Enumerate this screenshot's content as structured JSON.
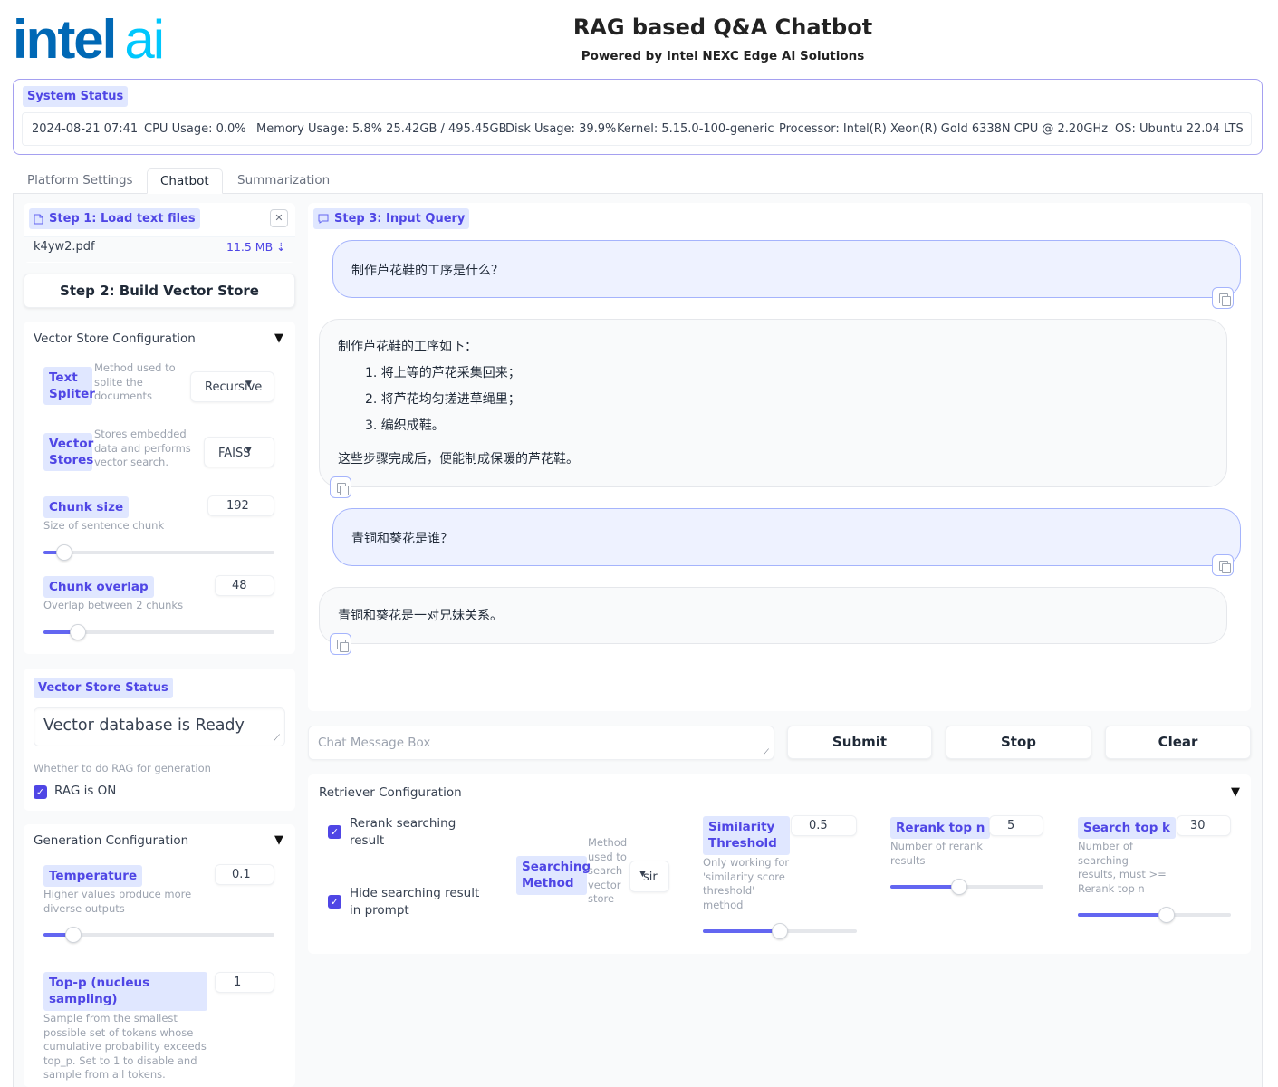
{
  "header": {
    "logo_intel": "intel",
    "logo_ai": "ai",
    "title": "RAG based Q&A Chatbot",
    "subtitle": "Powered by Intel NEXC Edge AI Solutions"
  },
  "system_status": {
    "label": "System Status",
    "datetime": "2024-08-21 07:41",
    "cpu": "CPU Usage: 0.0%",
    "memory": "Memory Usage: 5.8% 25.42GB / 495.45GB",
    "disk": "Disk Usage: 39.9%",
    "kernel": "Kernel: 5.15.0-100-generic",
    "processor": "Processor: Intel(R) Xeon(R) Gold 6338N CPU @ 2.20GHz",
    "os": "OS: Ubuntu 22.04 LTS"
  },
  "tabs": [
    {
      "label": "Platform Settings"
    },
    {
      "label": "Chatbot"
    },
    {
      "label": "Summarization"
    }
  ],
  "step1": {
    "label": "Step 1: Load text files",
    "file_name": "k4yw2.pdf",
    "file_size": "11.5 MB ⇣"
  },
  "step2": {
    "label": "Step 2: Build Vector Store"
  },
  "vector_store_config": {
    "title": "Vector Store Configuration",
    "text_splitter": {
      "label": "Text Spliter",
      "info": "Method used to splite the documents",
      "value": "Recursive"
    },
    "vector_stores": {
      "label": "Vector Stores",
      "info": "Stores embedded data and performs vector search.",
      "value": "FAISS"
    },
    "chunk_size": {
      "label": "Chunk size",
      "info": "Size of sentence chunk",
      "value": "192",
      "fraction": 0.09
    },
    "chunk_overlap": {
      "label": "Chunk overlap",
      "info": "Overlap between 2 chunks",
      "value": "48",
      "fraction": 0.15
    }
  },
  "vector_store_status": {
    "label": "Vector Store Status",
    "value": "Vector database is Ready",
    "rag_info": "Whether to do RAG for generation",
    "rag_label": "RAG is ON"
  },
  "generation_config": {
    "title": "Generation Configuration",
    "temperature": {
      "label": "Temperature",
      "info": "Higher values produce more diverse outputs",
      "value": "0.1",
      "fraction": 0.13
    },
    "top_p": {
      "label": "Top-p (nucleus sampling)",
      "info": "Sample from the smallest possible set of tokens whose cumulative probability exceeds top_p. Set to 1 to disable and sample from all tokens.",
      "value": "1"
    }
  },
  "chat": {
    "step3_label": "Step 3: Input Query",
    "messages": [
      {
        "role": "user",
        "text": "制作芦花鞋的工序是什么？"
      },
      {
        "role": "bot",
        "intro": "制作芦花鞋的工序如下：",
        "steps": [
          "1. 将上等的芦花采集回来；",
          "2. 将芦花均匀搓进草绳里；",
          "3. 编织成鞋。"
        ],
        "outro": "这些步骤完成后，便能制成保暖的芦花鞋。"
      },
      {
        "role": "user",
        "text": "青铜和葵花是谁？"
      },
      {
        "role": "bot",
        "text": "青铜和葵花是一对兄妹关系。"
      }
    ],
    "message_placeholder": "Chat Message Box",
    "submit": "Submit",
    "stop": "Stop",
    "clear": "Clear"
  },
  "retriever_config": {
    "title": "Retriever Configuration",
    "rerank_label": "Rerank searching result",
    "hide_label": "Hide searching result in prompt",
    "searching_method": {
      "label": "Searching Method",
      "info": "Method used to search vector store",
      "value": "sir"
    },
    "similarity": {
      "label": "Similarity Threshold",
      "info": "Only working for 'similarity score threshold' method",
      "value": "0.5",
      "fraction": 0.5
    },
    "rerank_top_n": {
      "label": "Rerank top n",
      "info": "Number of rerank results",
      "value": "5",
      "fraction": 0.45
    },
    "search_top_k": {
      "label": "Search top k",
      "info": "Number of searching results, must >= Rerank top n",
      "value": "30",
      "fraction": 0.58
    }
  },
  "colors": {
    "accent": "#4f46e5",
    "chip_bg": "#e0e7ff",
    "intel_blue": "#0068b5",
    "intel_cyan": "#00c7fd"
  }
}
